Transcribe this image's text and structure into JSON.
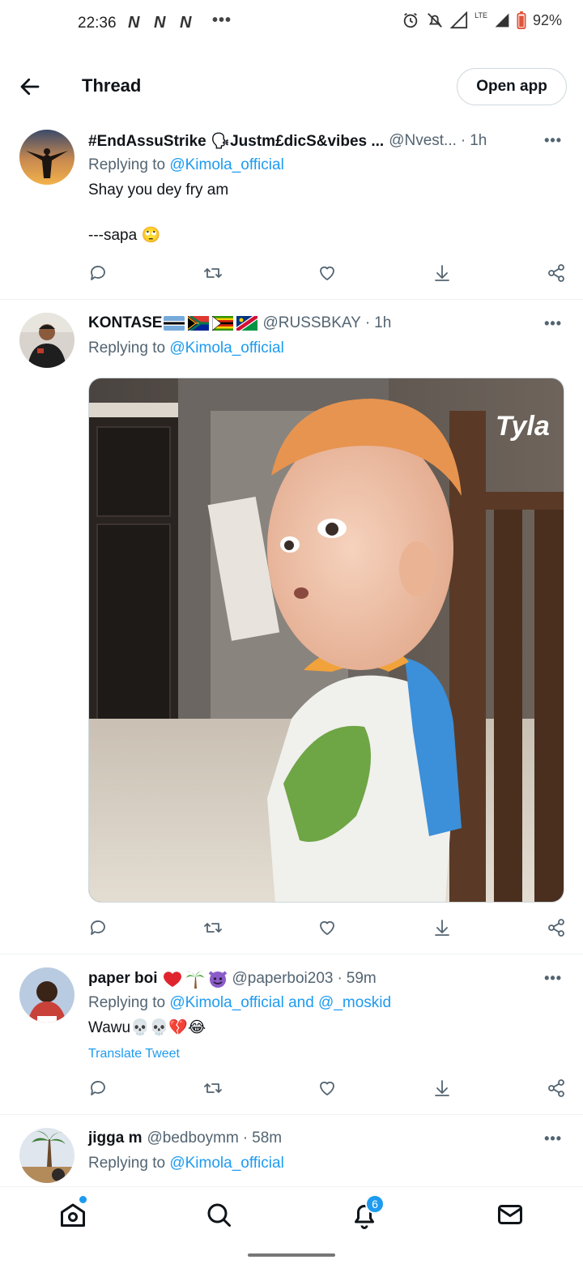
{
  "status_bar": {
    "time": "22:36",
    "n_glyph": "N",
    "more_dots": "•••",
    "lte": "LTE",
    "battery": "92%"
  },
  "header": {
    "title": "Thread",
    "open_app": "Open app"
  },
  "tweets": [
    {
      "name": "#EndAssuStrike 🗣Justm£dicS&vibes ...",
      "handle": "@Nvest...",
      "sep": "·",
      "time": "1h",
      "replying_prefix": "Replying to ",
      "mentions": "@Kimola_official",
      "text": "Shay you dey fry am\n\n---sapa 🙄"
    },
    {
      "name": "KONTASE",
      "flags": [
        "flag-botswana",
        "flag-south-africa",
        "flag-zimbabwe",
        "flag-namibia"
      ],
      "handle": "@RUSSBKAY",
      "sep": "·",
      "time": "1h",
      "replying_prefix": "Replying to ",
      "mentions": "@Kimola_official",
      "media_watermark": "Tyla"
    },
    {
      "name": "paper boi",
      "name_emojis": "❤️🌴😈",
      "handle": "@paperboi203",
      "sep": "·",
      "time": "59m",
      "replying_prefix": "Replying to ",
      "mentions": "@Kimola_official and @_moskid",
      "text": "Wawu💀💀💔😂",
      "translate": "Translate Tweet"
    },
    {
      "name": "jigga m",
      "handle": "@bedboymm",
      "sep": "·",
      "time": "58m",
      "replying_prefix": "Replying to ",
      "mentions": "@Kimola_official"
    }
  ],
  "more_label": "•••",
  "bottom_nav": {
    "notifications_badge": "6"
  },
  "colors": {
    "accent": "#1d9bf0",
    "secondary_text": "#536471",
    "divider": "#eff3f4"
  }
}
